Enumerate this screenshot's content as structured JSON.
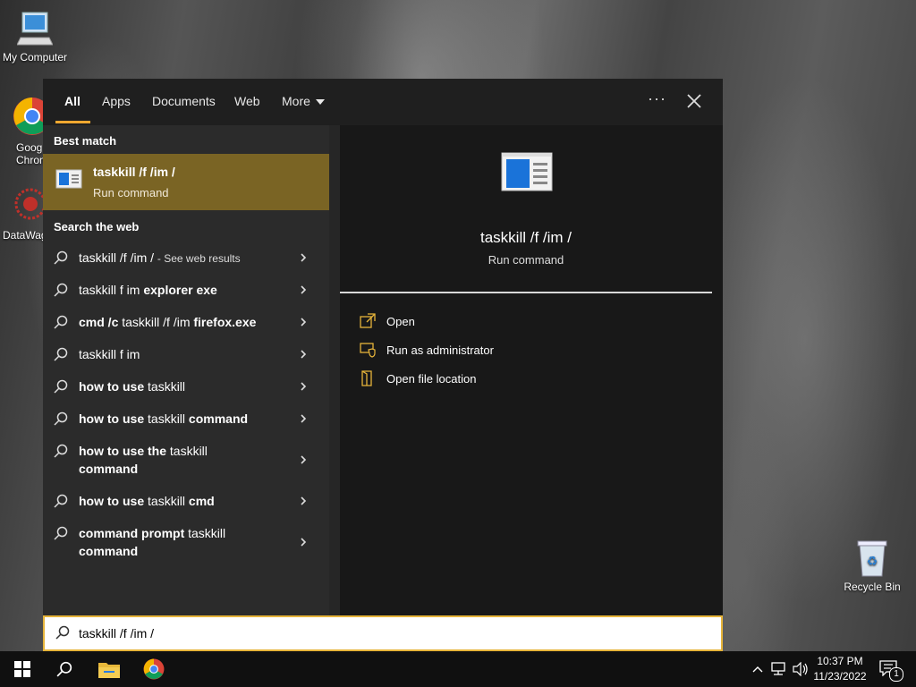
{
  "desktop": {
    "icons": [
      {
        "label": "My Computer"
      },
      {
        "label": "Goog\nChron"
      },
      {
        "label": "DataWag"
      },
      {
        "label": "Recycle Bin"
      }
    ]
  },
  "search": {
    "tabs": [
      "All",
      "Apps",
      "Documents",
      "Web",
      "More"
    ],
    "active_tab": "All",
    "best_match_header": "Best match",
    "best_match": {
      "title": "taskkill /f /im /",
      "subtitle": "Run command"
    },
    "web_header": "Search the web",
    "web_items": [
      {
        "plain": "taskkill /f /im / ",
        "bold": "",
        "suffix": "- See web results"
      },
      {
        "plain": "taskkill f im ",
        "bold": "explorer exe",
        "suffix": ""
      },
      {
        "plain_bold_first": "cmd /c",
        "plain": " taskkill /f /im ",
        "bold": "firefox.exe",
        "suffix": ""
      },
      {
        "plain": "taskkill f im",
        "bold": "",
        "suffix": ""
      },
      {
        "bold_first": "how to use",
        "plain": " taskkill",
        "bold": "",
        "suffix": ""
      },
      {
        "bold_first": "how to use",
        "plain": " taskkill ",
        "bold": "command",
        "suffix": ""
      },
      {
        "bold_first": "how to use the",
        "plain": " taskkill ",
        "bold": "command",
        "suffix": ""
      },
      {
        "bold_first": "how to use",
        "plain": " taskkill ",
        "bold": "cmd",
        "suffix": ""
      },
      {
        "bold_first": "command prompt",
        "plain": " taskkill ",
        "bold": "command",
        "suffix": ""
      }
    ],
    "preview": {
      "title": "taskkill /f /im /",
      "subtitle": "Run command"
    },
    "actions": [
      "Open",
      "Run as administrator",
      "Open file location"
    ],
    "query": "taskkill /f /im /"
  },
  "taskbar": {
    "time": "10:37 PM",
    "date": "11/23/2022",
    "notification_count": "1"
  },
  "colors": {
    "accent": "#f0a830",
    "best_match_bg": "#7a6424",
    "searchbox_border": "#e6b43a"
  }
}
